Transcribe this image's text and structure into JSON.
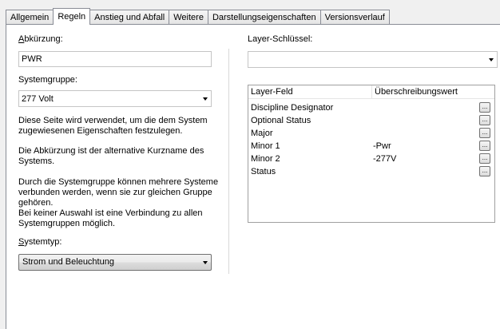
{
  "tabs": [
    "Allgemein",
    "Regeln",
    "Anstieg und Abfall",
    "Weitere",
    "Darstellungseigenschaften",
    "Versionsverlauf"
  ],
  "left": {
    "abbr_label_u": "A",
    "abbr_label_rest": "bkürzung:",
    "abbr_value": "PWR",
    "sysgroup_label": "Systemgruppe:",
    "sysgroup_value": "277 Volt",
    "desc1_l1": "Diese Seite wird verwendet, um die dem System",
    "desc1_l2": "zugewiesenen Eigenschaften festzulegen.",
    "desc2_l1": "Die Abkürzung ist der alternative Kurzname des",
    "desc2_l2": "Systems.",
    "desc3_l1": "Durch die Systemgruppe können mehrere Systeme",
    "desc3_l2": "verbunden werden, wenn sie zur gleichen Gruppe",
    "desc3_l3": "gehören.",
    "desc3_l4": "Bei keiner Auswahl ist eine Verbindung zu allen",
    "desc3_l5": "Systemgruppen möglich.",
    "systype_label_u": "S",
    "systype_label_rest": "ystemtyp:",
    "systype_value": "Strom und Beleuchtung"
  },
  "right": {
    "layerkey_label": "Layer-Schlüssel:",
    "layerkey_value": "",
    "col_field": "Layer-Feld",
    "col_override": "Überschreibungswert",
    "rows": [
      {
        "field": "Discipline Designator",
        "value": "",
        "btn": "..."
      },
      {
        "field": "Optional Status",
        "value": "",
        "btn": "..."
      },
      {
        "field": "Major",
        "value": "",
        "btn": "..."
      },
      {
        "field": "Minor 1",
        "value": "-Pwr",
        "btn": "..."
      },
      {
        "field": "Minor 2",
        "value": "-277V",
        "btn": "..."
      },
      {
        "field": "Status",
        "value": "",
        "btn": "..."
      }
    ]
  },
  "icons": {
    "dropdown": "chevron-down-icon",
    "ellipsis": "ellipsis-button"
  }
}
